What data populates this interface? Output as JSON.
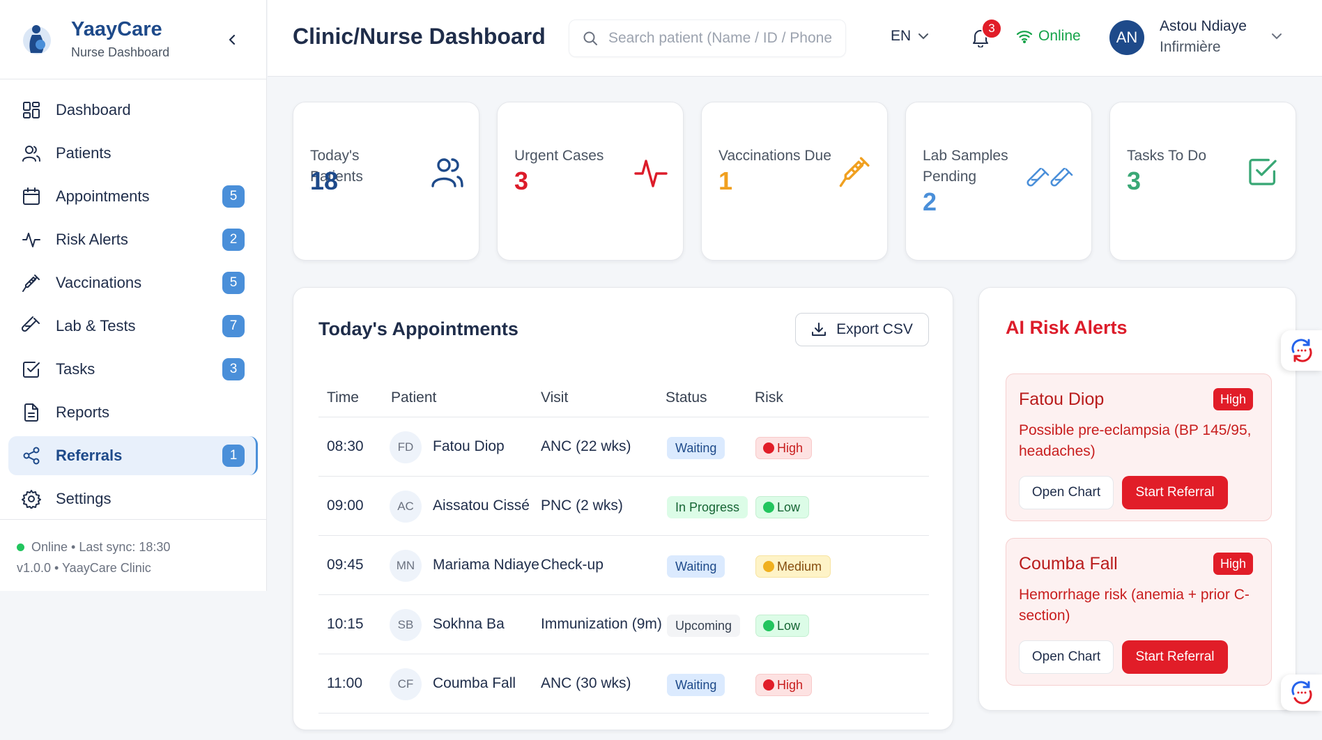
{
  "brand": {
    "title": "YaayCare",
    "subtitle": "Nurse Dashboard"
  },
  "sidebar": {
    "items": [
      {
        "label": "Dashboard",
        "icon": "grid-icon",
        "badge": ""
      },
      {
        "label": "Patients",
        "icon": "users-icon",
        "badge": ""
      },
      {
        "label": "Appointments",
        "icon": "calendar-icon",
        "badge": "5"
      },
      {
        "label": "Risk Alerts",
        "icon": "activity-icon",
        "badge": "2"
      },
      {
        "label": "Vaccinations",
        "icon": "syringe-icon",
        "badge": "5"
      },
      {
        "label": "Lab & Tests",
        "icon": "test-tube-icon",
        "badge": "7"
      },
      {
        "label": "Tasks",
        "icon": "check-square-icon",
        "badge": "3"
      },
      {
        "label": "Reports",
        "icon": "file-text-icon",
        "badge": ""
      },
      {
        "label": "Referrals",
        "icon": "share-icon",
        "badge": "1",
        "active": true
      },
      {
        "label": "Settings",
        "icon": "gear-icon",
        "badge": ""
      }
    ],
    "footer": {
      "status": "Online • Last sync: 18:30",
      "version": "v1.0.0 • YaayCare Clinic"
    }
  },
  "header": {
    "title": "Clinic/Nurse Dashboard",
    "search_placeholder": "Search patient (Name / ID / Phone)",
    "language": "EN",
    "notifications": "3",
    "connection": "Online",
    "user": {
      "initials": "AN",
      "name": "Astou Ndiaye",
      "role": "Infirmière"
    }
  },
  "stats": [
    {
      "label": "Today's Patients",
      "value": "18",
      "icon": "users-icon",
      "color": "#1e4a8a"
    },
    {
      "label": "Urgent Cases",
      "value": "3",
      "icon": "activity-icon",
      "color": "#dc1c2a"
    },
    {
      "label": "Vaccinations Due",
      "value": "1",
      "icon": "syringe-icon",
      "color": "#f0a020"
    },
    {
      "label": "Lab Samples Pending",
      "value": "2",
      "icon": "test-tube-icon",
      "color": "#4a8fd9"
    },
    {
      "label": "Tasks To Do",
      "value": "3",
      "icon": "check-square-icon",
      "color": "#3aa876"
    }
  ],
  "appointments": {
    "title": "Today's Appointments",
    "export_label": "Export CSV",
    "columns": [
      "Time",
      "Patient",
      "Visit",
      "Status",
      "Risk"
    ],
    "rows": [
      {
        "time": "08:30",
        "initials": "FD",
        "patient": "Fatou Diop",
        "visit": "ANC (22 wks)",
        "status": "Waiting",
        "risk": "High"
      },
      {
        "time": "09:00",
        "initials": "AC",
        "patient": "Aissatou Cissé",
        "visit": "PNC (2 wks)",
        "status": "In Progress",
        "risk": "Low"
      },
      {
        "time": "09:45",
        "initials": "MN",
        "patient": "Mariama Ndiaye",
        "visit": "Check-up",
        "status": "Waiting",
        "risk": "Medium"
      },
      {
        "time": "10:15",
        "initials": "SB",
        "patient": "Sokhna Ba",
        "visit": "Immunization (9m)",
        "status": "Upcoming",
        "risk": "Low"
      },
      {
        "time": "11:00",
        "initials": "CF",
        "patient": "Coumba Fall",
        "visit": "ANC (30 wks)",
        "status": "Waiting",
        "risk": "High"
      }
    ]
  },
  "alerts": {
    "title": "AI Risk Alerts",
    "items": [
      {
        "name": "Fatou Diop",
        "level": "High",
        "text": "Possible pre-eclampsia (BP 145/95, headaches)",
        "open_label": "Open Chart",
        "referral_label": "Start Referral"
      },
      {
        "name": "Coumba Fall",
        "level": "High",
        "text": "Hemorrhage risk (anemia + prior C-section)",
        "open_label": "Open Chart",
        "referral_label": "Start Referral"
      }
    ]
  }
}
